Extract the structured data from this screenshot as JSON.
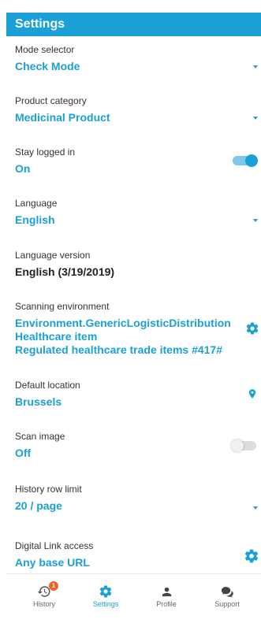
{
  "header": {
    "title": "Settings"
  },
  "settings": {
    "mode": {
      "label": "Mode selector",
      "value": "Check Mode"
    },
    "category": {
      "label": "Product category",
      "value": "Medicinal Product"
    },
    "stay_logged": {
      "label": "Stay logged in",
      "value": "On"
    },
    "language": {
      "label": "Language",
      "value": "English"
    },
    "language_version": {
      "label": "Language version",
      "value": "English (3/19/2019)"
    },
    "scanning_env": {
      "label": "Scanning environment",
      "lines": [
        "Environment.GenericLogisticDistribution",
        "Healthcare item",
        "Regulated healthcare trade items #417#"
      ]
    },
    "default_location": {
      "label": "Default location",
      "value": "Brussels"
    },
    "scan_image": {
      "label": "Scan image",
      "value": "Off"
    },
    "history_limit": {
      "label": "History row limit",
      "value": "20 / page"
    },
    "digital_link": {
      "label": "Digital Link access",
      "value": "Any base URL"
    }
  },
  "tabs": [
    {
      "label": "History",
      "badge": "1",
      "icon": "history-icon"
    },
    {
      "label": "Settings",
      "icon": "gear-icon",
      "active": true
    },
    {
      "label": "Profile",
      "icon": "person-icon"
    },
    {
      "label": "Support",
      "icon": "chat-icon"
    }
  ],
  "colors": {
    "accent": "#1a9fd6",
    "badge": "#f0621f"
  }
}
